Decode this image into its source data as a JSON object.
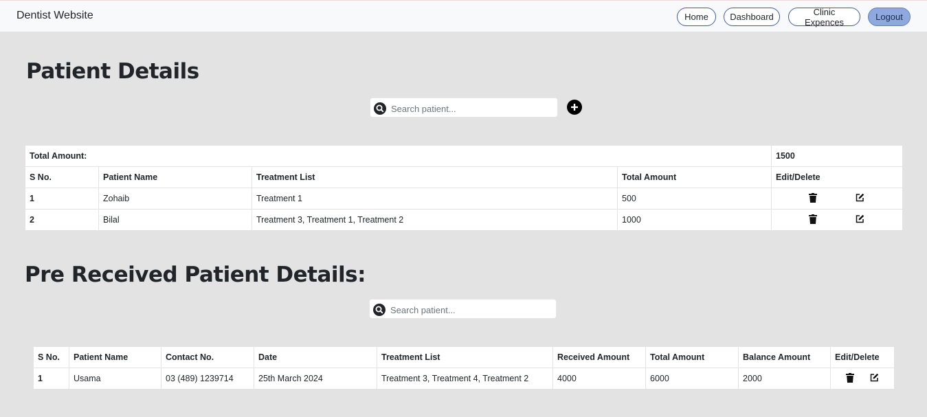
{
  "navbar": {
    "brand": "Dentist Website",
    "links": [
      "Home",
      "Dashboard",
      "Clinic Expences",
      "Logout"
    ]
  },
  "patient_details": {
    "title": "Patient Details",
    "search_placeholder": "Search patient...",
    "total_label": "Total Amount:",
    "total_value": "1500",
    "columns": [
      "S No.",
      "Patient Name",
      "Treatment List",
      "Total Amount",
      "Edit/Delete"
    ],
    "rows": [
      [
        "1",
        "Zohaib",
        "Treatment 1",
        "500"
      ],
      [
        "2",
        "Bilal",
        "Treatment 3, Treatment 1, Treatment 2",
        "1000"
      ]
    ]
  },
  "pre_received": {
    "title": "Pre Received Patient Details:",
    "search_placeholder": "Search patient...",
    "columns": [
      "S No.",
      "Patient Name",
      "Contact No.",
      "Date",
      "Treatment List",
      "Received Amount",
      "Total Amount",
      "Balance Amount",
      "Edit/Delete"
    ],
    "rows": [
      [
        "1",
        "Usama",
        "03 (489) 1239714",
        "25th March 2024",
        "Treatment 3, Treatment 4, Treatment 2",
        "4000",
        "6000",
        "2000"
      ]
    ]
  },
  "icons": {
    "search": "search-icon",
    "add": "plus-circle-icon",
    "delete": "trash-icon",
    "edit": "edit-icon"
  },
  "colors": {
    "page_bg": "#e3e3e3",
    "navbar_bg": "#f8f9fa",
    "logout_bg": "#8fa9df",
    "button_border": "#3b5aa8"
  }
}
